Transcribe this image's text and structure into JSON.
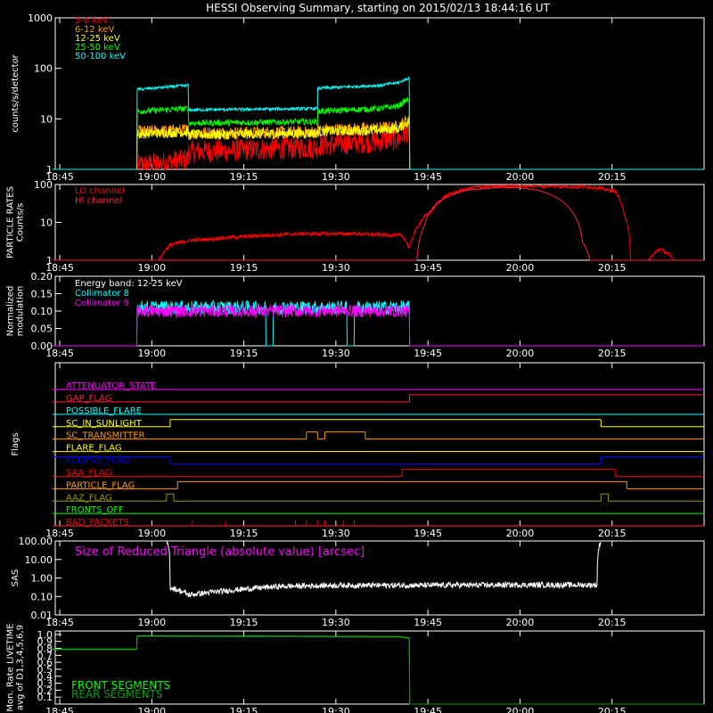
{
  "title": "HESSI Observing Summary, starting on 2015/02/13 18:44:16 UT",
  "time_ticks": [
    "18:45",
    "19:00",
    "19:15",
    "19:30",
    "19:45",
    "20:00",
    "20:15"
  ],
  "colors": {
    "red": "#ff0000",
    "orange": "#ff9900",
    "yellow": "#ffff00",
    "green": "#00ff00",
    "cyan": "#00ffff",
    "crimson": "#ff2040",
    "magenta": "#ff00ff",
    "blue": "#0000ff",
    "olive": "#999900",
    "white": "#ffffff"
  },
  "chart_data": [
    {
      "id": "counts",
      "type": "line",
      "ylabel": "counts/s/detector",
      "yscale": "log",
      "ylim": [
        1,
        1000
      ],
      "yticks": [
        "1",
        "10",
        "100",
        "1000"
      ],
      "legend": [
        "3-6 keV",
        "6-12 keV",
        "12-25 keV",
        "25-50 keV",
        "50-100 keV"
      ],
      "series": [
        {
          "name": "3-6 keV",
          "color": "#ff0000",
          "noise": 0.45,
          "points": [
            [
              18.73,
              1
            ],
            [
              18.96,
              1
            ],
            [
              18.96,
              1.2
            ],
            [
              19.02,
              1.3
            ],
            [
              19.08,
              1.5
            ],
            [
              19.1,
              1.6
            ],
            [
              19.1,
              2.2
            ],
            [
              19.25,
              2.4
            ],
            [
              19.4,
              2.7
            ],
            [
              19.45,
              2.7
            ],
            [
              19.45,
              3
            ],
            [
              19.6,
              3.5
            ],
            [
              19.67,
              4
            ],
            [
              19.7,
              6
            ],
            [
              19.7,
              1
            ],
            [
              20.5,
              1
            ]
          ]
        },
        {
          "name": "6-12 keV",
          "color": "#ff9900",
          "noise": 0.25,
          "points": [
            [
              18.73,
              1
            ],
            [
              18.96,
              1
            ],
            [
              18.96,
              5.5
            ],
            [
              19.1,
              6
            ],
            [
              19.1,
              5.2
            ],
            [
              19.45,
              5.5
            ],
            [
              19.45,
              6
            ],
            [
              19.62,
              6.5
            ],
            [
              19.67,
              7
            ],
            [
              19.7,
              10
            ],
            [
              19.7,
              1
            ],
            [
              20.5,
              1
            ]
          ]
        },
        {
          "name": "12-25 keV",
          "color": "#ffff00",
          "noise": 0.2,
          "points": [
            [
              18.73,
              1
            ],
            [
              18.96,
              1
            ],
            [
              18.96,
              5
            ],
            [
              19.1,
              5.5
            ],
            [
              19.1,
              4.8
            ],
            [
              19.45,
              5.2
            ],
            [
              19.45,
              5.6
            ],
            [
              19.62,
              6
            ],
            [
              19.67,
              6.5
            ],
            [
              19.7,
              9
            ],
            [
              19.7,
              1
            ],
            [
              20.5,
              1
            ]
          ]
        },
        {
          "name": "25-50 keV",
          "color": "#00ff00",
          "noise": 0.12,
          "points": [
            [
              18.73,
              1
            ],
            [
              18.96,
              1
            ],
            [
              18.96,
              14
            ],
            [
              19.1,
              16
            ],
            [
              19.1,
              8.2
            ],
            [
              19.45,
              8.8
            ],
            [
              19.45,
              14
            ],
            [
              19.62,
              16
            ],
            [
              19.67,
              18
            ],
            [
              19.7,
              25
            ],
            [
              19.7,
              1
            ],
            [
              20.5,
              1
            ]
          ]
        },
        {
          "name": "50-100 keV",
          "color": "#00ffff",
          "noise": 0.06,
          "points": [
            [
              18.73,
              1
            ],
            [
              18.96,
              1
            ],
            [
              18.96,
              38
            ],
            [
              19.1,
              46
            ],
            [
              19.1,
              15
            ],
            [
              19.45,
              16
            ],
            [
              19.45,
              40
            ],
            [
              19.62,
              46
            ],
            [
              19.67,
              52
            ],
            [
              19.7,
              65
            ],
            [
              19.7,
              1
            ],
            [
              20.5,
              1
            ]
          ]
        }
      ]
    },
    {
      "id": "particles",
      "type": "line",
      "ylabel": "PARTICLE RATES\nCounts/s",
      "yscale": "log",
      "ylim": [
        1,
        100
      ],
      "yticks": [
        "1",
        "10",
        "100"
      ],
      "legend": [
        "LO channel",
        "HI channel"
      ],
      "series": [
        {
          "name": "LO channel",
          "color": "#ff0000",
          "noise": 0.1,
          "points": [
            [
              18.73,
              1
            ],
            [
              19.02,
              1
            ],
            [
              19.05,
              2.5
            ],
            [
              19.1,
              3.3
            ],
            [
              19.25,
              4.2
            ],
            [
              19.4,
              5
            ],
            [
              19.55,
              5
            ],
            [
              19.68,
              4.5
            ],
            [
              19.7,
              2
            ],
            [
              19.72,
              7
            ],
            [
              19.76,
              20
            ],
            [
              19.8,
              50
            ],
            [
              19.85,
              75
            ],
            [
              19.9,
              88
            ],
            [
              20.0,
              92
            ],
            [
              20.1,
              90
            ],
            [
              20.2,
              85
            ],
            [
              20.26,
              65
            ],
            [
              20.28,
              20
            ],
            [
              20.3,
              1
            ],
            [
              20.35,
              1
            ],
            [
              20.38,
              2
            ],
            [
              20.42,
              1
            ],
            [
              20.5,
              1
            ]
          ]
        },
        {
          "name": "HI channel",
          "color": "#ff2040",
          "noise": 0.0,
          "points": [
            [
              18.73,
              1
            ],
            [
              19.72,
              1
            ],
            [
              19.74,
              8
            ],
            [
              19.78,
              35
            ],
            [
              19.85,
              70
            ],
            [
              19.95,
              85
            ],
            [
              20.0,
              82
            ],
            [
              20.05,
              70
            ],
            [
              20.1,
              45
            ],
            [
              20.14,
              20
            ],
            [
              20.17,
              3
            ],
            [
              20.19,
              1
            ],
            [
              20.5,
              1
            ]
          ]
        }
      ]
    },
    {
      "id": "modulation",
      "type": "line",
      "ylabel": "Normalized\nmodulation",
      "yscale": "linear",
      "ylim": [
        0,
        0.2
      ],
      "yticks": [
        "0.00",
        "0.05",
        "0.10",
        "0.15",
        "0.20"
      ],
      "legend": [
        "Energy band: 12-25 keV",
        "Collimator 8",
        "Collimator 9"
      ],
      "series": [
        {
          "name": "Collimator 8",
          "color": "#00ffff",
          "noise": 0.02,
          "points": [
            [
              18.73,
              0
            ],
            [
              18.96,
              0
            ],
            [
              18.96,
              0.11
            ],
            [
              19.31,
              0.11
            ],
            [
              19.31,
              0
            ],
            [
              19.33,
              0
            ],
            [
              19.33,
              0.11
            ],
            [
              19.53,
              0.11
            ],
            [
              19.53,
              0
            ],
            [
              19.55,
              0
            ],
            [
              19.55,
              0.11
            ],
            [
              19.7,
              0.11
            ],
            [
              19.7,
              0
            ],
            [
              20.5,
              0
            ]
          ]
        },
        {
          "name": "Collimator 9",
          "color": "#ff00ff",
          "noise": 0.018,
          "points": [
            [
              18.73,
              0
            ],
            [
              18.96,
              0
            ],
            [
              18.96,
              0.1
            ],
            [
              19.7,
              0.1
            ],
            [
              19.7,
              0
            ],
            [
              20.5,
              0
            ]
          ]
        }
      ]
    },
    {
      "id": "flags",
      "type": "line",
      "ylabel": "Flags",
      "flags": [
        {
          "name": "ATTENUATOR_STATE",
          "color": "#ff00ff",
          "segments": [
            [
              18.73,
              20.5,
              0
            ]
          ]
        },
        {
          "name": "GAP_FLAG",
          "color": "#ff2040",
          "segments": [
            [
              18.73,
              19.7,
              0
            ],
            [
              19.7,
              20.5,
              1
            ]
          ]
        },
        {
          "name": "POSSIBLE_FLARE",
          "color": "#00ffff",
          "segments": [
            [
              18.73,
              20.5,
              0
            ]
          ]
        },
        {
          "name": "SC_IN_SUNLIGHT",
          "color": "#ffff00",
          "segments": [
            [
              18.73,
              19.05,
              0
            ],
            [
              19.05,
              20.22,
              1
            ],
            [
              20.22,
              20.5,
              0
            ]
          ]
        },
        {
          "name": "SC_TRANSMITTER",
          "color": "#ff9900",
          "segments": [
            [
              18.73,
              19.42,
              0
            ],
            [
              19.42,
              19.45,
              1
            ],
            [
              19.45,
              19.47,
              0
            ],
            [
              19.47,
              19.58,
              1
            ],
            [
              19.58,
              20.5,
              0
            ]
          ]
        },
        {
          "name": "FLARE_FLAG",
          "color": "#ffff00",
          "segments": [
            [
              18.73,
              20.5,
              0
            ]
          ]
        },
        {
          "name": "ECLIPSE_FLAG",
          "color": "#0000ff",
          "segments": [
            [
              18.73,
              19.05,
              1
            ],
            [
              19.05,
              20.22,
              0
            ],
            [
              20.22,
              20.5,
              1
            ]
          ]
        },
        {
          "name": "SAA_FLAG",
          "color": "#ff0000",
          "segments": [
            [
              18.73,
              19.68,
              0
            ],
            [
              19.68,
              20.26,
              1
            ],
            [
              20.26,
              20.5,
              0
            ]
          ]
        },
        {
          "name": "PARTICLE_FLAG",
          "color": "#ff9900",
          "segments": [
            [
              18.73,
              19.07,
              0
            ],
            [
              19.07,
              20.29,
              1
            ],
            [
              20.29,
              20.5,
              0
            ]
          ]
        },
        {
          "name": "AAZ_FLAG",
          "color": "#999900",
          "segments": [
            [
              18.73,
              19.04,
              0
            ],
            [
              19.04,
              19.06,
              1
            ],
            [
              19.06,
              20.22,
              0
            ],
            [
              20.22,
              20.24,
              1
            ],
            [
              20.24,
              20.5,
              0
            ]
          ]
        },
        {
          "name": "FRONTS_OFF",
          "color": "#00ff00",
          "segments": [
            [
              18.73,
              20.5,
              0
            ]
          ]
        },
        {
          "name": "BAD_PACKETS",
          "color": "#ff0000",
          "segments": [
            [
              18.73,
              20.5,
              0
            ]
          ],
          "spikes": [
            19.11,
            19.2,
            19.39,
            19.42,
            19.45,
            19.47,
            19.52,
            19.55
          ]
        }
      ]
    },
    {
      "id": "sas",
      "type": "line",
      "ylabel": "SAS",
      "yscale": "log",
      "ylim": [
        0.01,
        100
      ],
      "yticks": [
        "0.01",
        "0.10",
        "1.00",
        "10.00",
        "100.00"
      ],
      "legend": [
        "Size of Reduced Triangle (absolute value) [arcsec]"
      ],
      "series": [
        {
          "name": "Size of Reduced Triangle (absolute value) [arcsec]",
          "color": "#ffffff",
          "noise": 0.3,
          "points": [
            [
              19.04,
              100
            ],
            [
              19.05,
              0.3
            ],
            [
              19.1,
              0.12
            ],
            [
              19.2,
              0.2
            ],
            [
              19.35,
              0.35
            ],
            [
              19.5,
              0.4
            ],
            [
              19.7,
              0.4
            ],
            [
              20.0,
              0.42
            ],
            [
              20.21,
              0.42
            ],
            [
              20.22,
              100
            ]
          ]
        }
      ]
    },
    {
      "id": "livetime",
      "type": "line",
      "ylabel": "Mon. Rate LIVETIME\navg of D1,3,4,5,6,9",
      "yscale": "linear",
      "ylim": [
        0,
        1.05
      ],
      "yticks": [
        "0.1",
        "0.2",
        "0.3",
        "0.4",
        "0.5",
        "0.6",
        "0.7",
        "0.8",
        "0.9",
        "1.0"
      ],
      "legend": [
        "FRONT SEGMENTS",
        "REAR SEGMENTS"
      ],
      "series": [
        {
          "name": "FRONT SEGMENTS",
          "color": "#00ff00",
          "noise": 0.0,
          "points": [
            [
              18.73,
              0.79
            ],
            [
              18.96,
              0.79
            ],
            [
              18.96,
              0.98
            ],
            [
              19.67,
              0.97
            ],
            [
              19.7,
              0.95
            ],
            [
              19.7,
              0
            ],
            [
              20.5,
              0
            ]
          ]
        },
        {
          "name": "REAR SEGMENTS",
          "color": "#00a000",
          "noise": 0.0,
          "points": [
            [
              18.73,
              0.785
            ],
            [
              18.96,
              0.785
            ],
            [
              18.96,
              0.975
            ],
            [
              19.67,
              0.965
            ],
            [
              19.7,
              0.945
            ],
            [
              19.7,
              0
            ],
            [
              20.5,
              0
            ]
          ]
        }
      ]
    }
  ]
}
